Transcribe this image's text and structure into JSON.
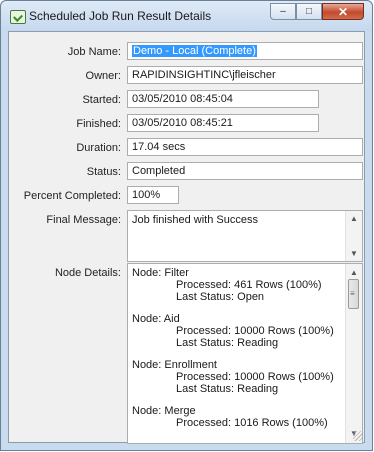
{
  "window": {
    "title": "Scheduled Job Run Result Details",
    "minimize": "–",
    "maximize": "□",
    "close": "✕"
  },
  "fields": {
    "job_name": {
      "label": "Job Name:",
      "value": "Demo - Local (Complete)"
    },
    "owner": {
      "label": "Owner:",
      "value": "RAPIDINSIGHTINC\\jfleischer"
    },
    "started": {
      "label": "Started:",
      "value": "03/05/2010 08:45:04"
    },
    "finished": {
      "label": "Finished:",
      "value": "03/05/2010 08:45:21"
    },
    "duration": {
      "label": "Duration:",
      "value": "17.04 secs"
    },
    "status": {
      "label": "Status:",
      "value": "Completed"
    },
    "percent": {
      "label": "Percent Completed:",
      "value": "100%"
    },
    "final_message": {
      "label": "Final Message:",
      "value": "Job finished with Success"
    },
    "node_details": {
      "label": "Node Details:"
    }
  },
  "nodes": [
    {
      "title": "Node: Filter",
      "processed": "Processed: 461 Rows (100%)",
      "last_status": "Last Status: Open"
    },
    {
      "title": "Node: Aid",
      "processed": "Processed: 10000 Rows (100%)",
      "last_status": "Last Status: Reading"
    },
    {
      "title": "Node: Enrollment",
      "processed": "Processed: 10000 Rows (100%)",
      "last_status": "Last Status: Reading"
    },
    {
      "title": "Node: Merge",
      "processed": "Processed: 1016 Rows (100%)",
      "last_status": ""
    }
  ],
  "icons": {
    "window": "green-check-window-icon",
    "scroll_up": "scroll-up-arrow-icon",
    "scroll_down": "scroll-down-arrow-icon"
  }
}
